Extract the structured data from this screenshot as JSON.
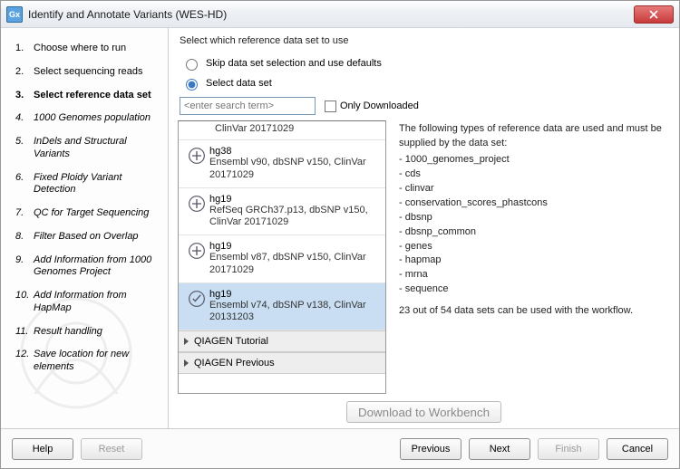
{
  "window": {
    "title": "Identify and Annotate Variants (WES-HD)",
    "app_icon_text": "Gx"
  },
  "steps": [
    {
      "label": "Choose where to run"
    },
    {
      "label": "Select sequencing reads"
    },
    {
      "label": "Select reference data set",
      "current": true
    },
    {
      "label": "1000 Genomes population",
      "italic": true
    },
    {
      "label": "InDels and Structural Variants",
      "italic": true
    },
    {
      "label": "Fixed Ploidy Variant Detection",
      "italic": true
    },
    {
      "label": "QC for Target Sequencing",
      "italic": true
    },
    {
      "label": "Filter Based on Overlap",
      "italic": true
    },
    {
      "label": "Add Information from 1000 Genomes Project",
      "italic": true
    },
    {
      "label": "Add Information from HapMap",
      "italic": true
    },
    {
      "label": "Result handling",
      "italic": true
    },
    {
      "label": "Save location for new elements",
      "italic": true
    }
  ],
  "main": {
    "instruction": "Select which reference data set to use",
    "radio_skip": "Skip data set selection and use defaults",
    "radio_select": "Select data set",
    "radio_selected": "select",
    "search_placeholder": "<enter search term>",
    "only_downloaded": "Only Downloaded",
    "partial_top_item": "ClinVar 20171029",
    "datasets": [
      {
        "name": "hg38",
        "desc": "Ensembl v90, dbSNP v150, ClinVar 20171029",
        "selected": false,
        "icon": "plus"
      },
      {
        "name": "hg19",
        "desc": "RefSeq GRCh37.p13, dbSNP v150, ClinVar 20171029",
        "selected": false,
        "icon": "plus"
      },
      {
        "name": "hg19",
        "desc": "Ensembl v87, dbSNP v150, ClinVar 20171029",
        "selected": false,
        "icon": "plus"
      },
      {
        "name": "hg19",
        "desc": "Ensembl v74, dbSNP v138, ClinVar 20131203",
        "selected": true,
        "icon": "check"
      }
    ],
    "groups": [
      {
        "label": "QIAGEN Tutorial"
      },
      {
        "label": "QIAGEN Previous"
      }
    ],
    "download_label": "Download to Workbench"
  },
  "info": {
    "intro": "The following types of reference data are used and must be supplied by the data set:",
    "types": [
      "1000_genomes_project",
      "cds",
      "clinvar",
      "conservation_scores_phastcons",
      "dbsnp",
      "dbsnp_common",
      "genes",
      "hapmap",
      "mrna",
      "sequence"
    ],
    "summary": "23 out of 54 data sets can be used with the workflow."
  },
  "footer": {
    "help": "Help",
    "reset": "Reset",
    "previous": "Previous",
    "next": "Next",
    "finish": "Finish",
    "cancel": "Cancel"
  }
}
